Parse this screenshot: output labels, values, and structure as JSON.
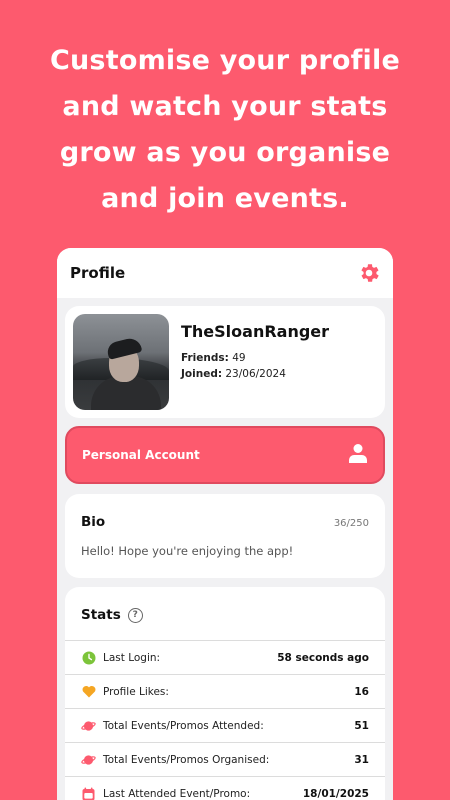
{
  "headline": [
    "Customise your profile",
    "and watch your stats",
    "grow as you organise",
    "and join events."
  ],
  "appbar": {
    "title": "Profile",
    "settings_icon": "gear-icon"
  },
  "profile": {
    "username": "TheSloanRanger",
    "friends_label": "Friends:",
    "friends_value": "49",
    "joined_label": "Joined:",
    "joined_value": "23/06/2024"
  },
  "account": {
    "label": "Personal Account",
    "icon": "person-icon"
  },
  "bio": {
    "title": "Bio",
    "count": "36/250",
    "text": "Hello! Hope you're enjoying the app!"
  },
  "stats": {
    "title": "Stats",
    "help_glyph": "?",
    "rows": [
      {
        "icon": "clock-icon",
        "label": "Last Login:",
        "value": "58 seconds ago"
      },
      {
        "icon": "heart-icon",
        "label": "Profile Likes:",
        "value": "16"
      },
      {
        "icon": "planet-icon",
        "label": "Total Events/Promos Attended:",
        "value": "51"
      },
      {
        "icon": "planet-icon",
        "label": "Total Events/Promos Organised:",
        "value": "31"
      },
      {
        "icon": "calendar-icon",
        "label": "Last Attended Event/Promo:",
        "value": "18/01/2025"
      }
    ]
  },
  "colors": {
    "background": "#fd5a6e",
    "accent": "#fd5a6e",
    "clock": "#7cc43a",
    "heart": "#f5a623",
    "planet": "#fd5a6e"
  }
}
